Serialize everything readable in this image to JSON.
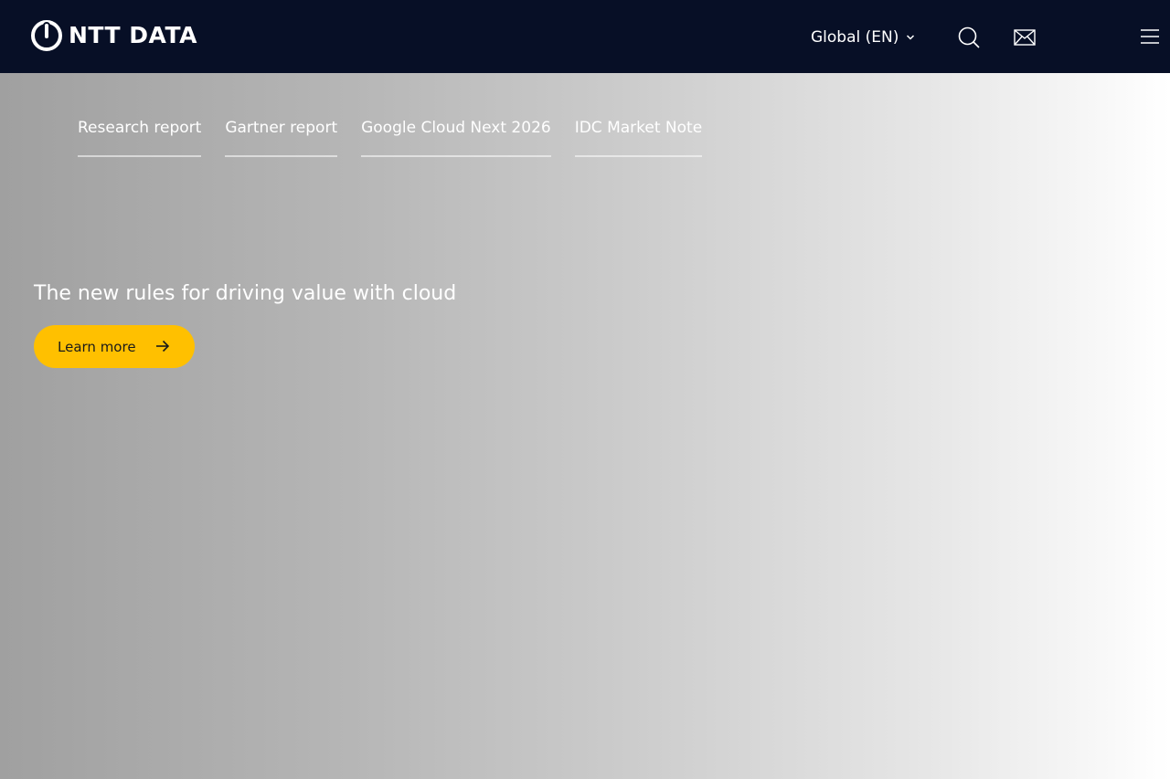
{
  "header": {
    "logo_text": "NTT DATA",
    "region_label": "Global (EN)",
    "icons": {
      "logo": "power-symbol-icon",
      "region": "chevron-down-icon",
      "search": "search-icon",
      "contact": "mail-icon",
      "menu": "hamburger-menu-icon"
    }
  },
  "hero": {
    "tabs": [
      {
        "label": "Research report"
      },
      {
        "label": "Gartner report"
      },
      {
        "label": "Google Cloud Next 2026"
      },
      {
        "label": "IDC Market Note"
      }
    ],
    "headline": "The new rules for driving value with cloud",
    "cta_label": "Learn more",
    "cta_icon": "arrow-right-icon"
  },
  "colors": {
    "header_bg": "#070f26",
    "accent": "#ffc000",
    "text_light": "#ffffff"
  }
}
